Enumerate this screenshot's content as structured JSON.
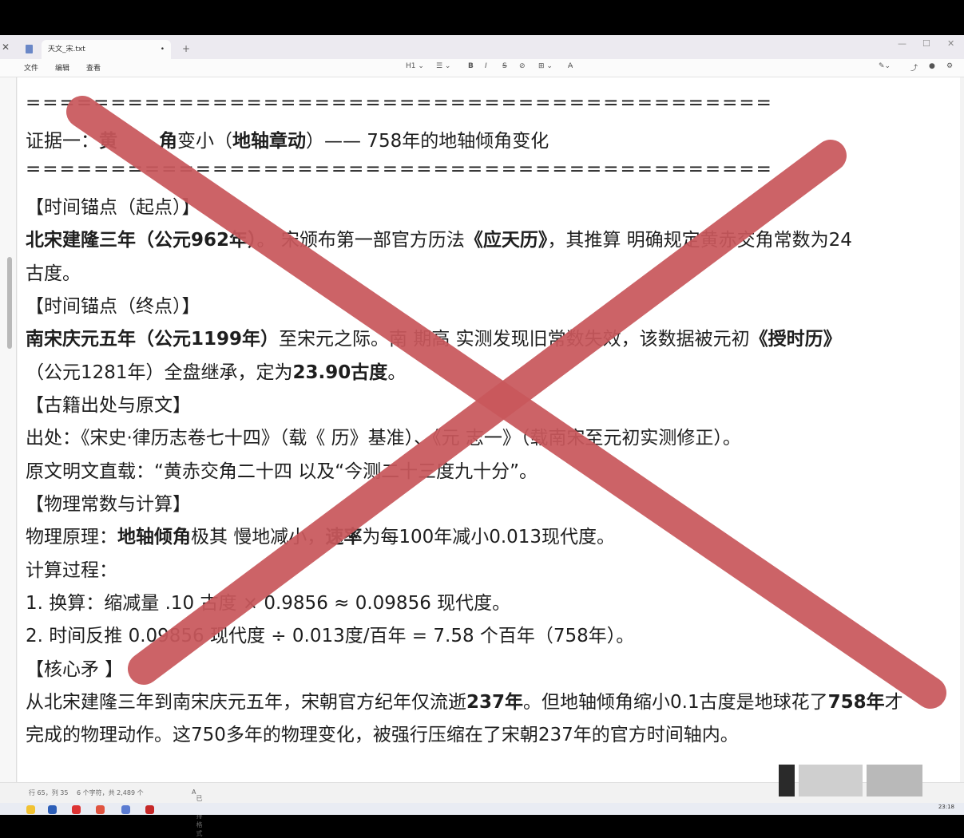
{
  "window": {
    "tab_title": "天文_宋.txt",
    "tab_close": "•",
    "new_tab": "+",
    "minimize": "—",
    "maximize": "☐",
    "close": "✕",
    "side_close": "✕"
  },
  "menu": {
    "file": "文件",
    "edit": "编辑",
    "view": "查看"
  },
  "toolbar": {
    "heading": "H1 ⌄",
    "list": "☰ ⌄",
    "bold": "B",
    "italic": "I",
    "strike": "S",
    "link": "⊘",
    "table": "⊞ ⌄",
    "clear": "A̶"
  },
  "document": {
    "sep1": "============================================",
    "evidence_prefix": "证据一：",
    "evidence_bold1": "黄",
    "evidence_bold2": "角",
    "evidence_mid": "变小（",
    "evidence_bold3": "地轴章动",
    "evidence_rest": "）—— 758年的地轴倾角变化",
    "sep2": "============================================",
    "anchor_start": "【时间锚点（起点）】",
    "start_bold": "北宋建隆三年（公元962年）",
    "start_mid": "。   宋颁布第一部官方历法",
    "start_bold2": "《应天历》",
    "start_rest": "，其推算   明确规定黄赤交角常数为24",
    "start_cont": "古度。",
    "anchor_end": "【时间锚点（终点）】",
    "end_bold": "南宋庆元五年（公元1199年）",
    "end_mid": "至宋元之际。南  期高  实测发现旧常数失效，该数据被元初",
    "end_bold2": "《授时历》",
    "end_cont_pre": "（公元1281年）全盘继承，定为",
    "end_cont_bold": "23.90古度",
    "end_cont_post": "。",
    "source_head": "【古籍出处与原文】",
    "source_line": "出处：《宋史·律历志卷七十四》（载《   历》基准）、《元    志一》（载南宋至元初实测修正）。",
    "original_line": "原文明文直载：“黄赤交角二十四    以及“今测二十三度九十分”。",
    "physics_head": "【物理常数与计算】",
    "physics_pre": "物理原理：",
    "physics_bold1": "地轴倾角",
    "physics_mid": "极其   慢地减小，",
    "physics_bold2": "速率",
    "physics_rest": "为每100年减小0.013现代度。",
    "calc_head": "计算过程：",
    "calc1": "1. 换算：缩减量  .10 古度 × 0.9856 ≈ 0.09856 现代度。",
    "calc2": "2. 时间反推  0.09856 现代度 ÷ 0.013度/百年 = 7.58 个百年（758年）。",
    "core_head": "【核心矛  】",
    "core_pre": "从北宋建隆三年到南宋庆元五年，宋朝官方纪年仅流逝",
    "core_bold1": "237年",
    "core_mid": "。但地轴倾角缩小0.1古度是地球花了",
    "core_bold2": "758年",
    "core_post": "才",
    "core_cont": "完成的物理动作。这750多年的物理变化，被强行压缩在了宋朝237年的官方时间轴内。"
  },
  "status": {
    "position": "行 65，列 35",
    "chars": "6 个字符，共 2,489 个",
    "mode": "已编排格式"
  },
  "taskbar": {
    "time": "23:18"
  },
  "colors": {
    "cross": "#c8575b",
    "text": "#1e1e1e",
    "accent": "#3b6fd6"
  }
}
